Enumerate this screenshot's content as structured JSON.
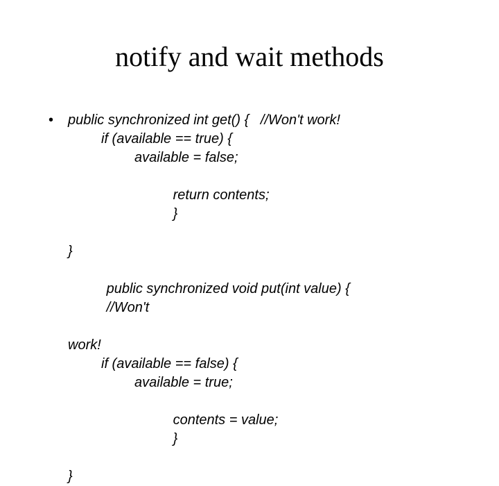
{
  "title": "notify and wait methods",
  "bullet": "•",
  "code": {
    "l1": "public synchronized int get() {   //Won't work!",
    "l2": "if (available == true) {",
    "l3": "available = false;",
    "l4a": "return contents;",
    "l4b": "}",
    "l5": "}",
    "l6a": "public synchronized void put(int value) {",
    "l6b": "//Won't",
    "l7": "work!",
    "l8": "if (available == false) {",
    "l9": "available = true;",
    "l10a": "contents = value;",
    "l10b": "}",
    "l11": "}"
  }
}
